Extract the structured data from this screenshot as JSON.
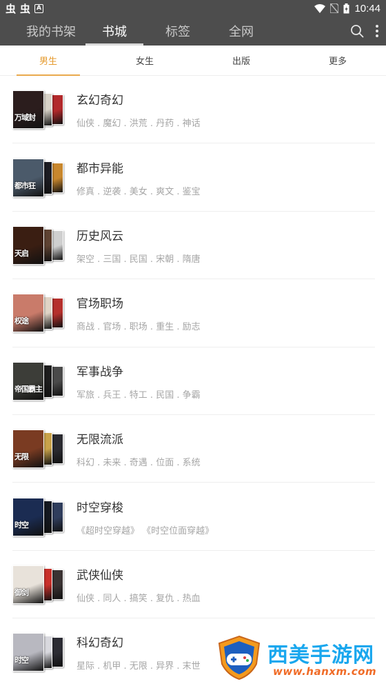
{
  "status_bar": {
    "app_glyphs": [
      "虫",
      "虫"
    ],
    "notif_letter": "A",
    "time": "10:44"
  },
  "top_nav": {
    "tabs": [
      {
        "label": "我的书架",
        "active": false
      },
      {
        "label": "书城",
        "active": true
      },
      {
        "label": "标签",
        "active": false
      },
      {
        "label": "全网",
        "active": false
      }
    ],
    "icons": [
      "search-icon",
      "more-vert-icon"
    ]
  },
  "sub_tabs": [
    {
      "label": "男生",
      "active": true
    },
    {
      "label": "女生",
      "active": false
    },
    {
      "label": "出版",
      "active": false
    },
    {
      "label": "更多",
      "active": false
    }
  ],
  "categories": [
    {
      "name": "玄幻奇幻",
      "tags": "仙侠 . 魔幻 . 洪荒 . 丹药 . 神话",
      "cover_title": "万域封",
      "colors": [
        "#2b1d1d",
        "#d8d2c8",
        "#b2292b"
      ]
    },
    {
      "name": "都市异能",
      "tags": "修真 . 逆袭 . 美女 . 爽文 . 鉴宝",
      "cover_title": "都市狂",
      "colors": [
        "#4b5a6a",
        "#1c1c22",
        "#c8872d"
      ]
    },
    {
      "name": "历史风云",
      "tags": "架空 . 三国 . 民国 . 宋朝 . 隋唐",
      "cover_title": "天启",
      "colors": [
        "#3a1e12",
        "#5e4232",
        "#cfcfcf"
      ]
    },
    {
      "name": "官场职场",
      "tags": "商战 . 官场 . 职场 . 重生 . 励志",
      "cover_title": "权途",
      "colors": [
        "#c97b6a",
        "#e0d4c6",
        "#b5302c"
      ]
    },
    {
      "name": "军事战争",
      "tags": "军旅 . 兵王 . 特工 . 民国 . 争霸",
      "cover_title": "帝国霸主",
      "colors": [
        "#3c3d38",
        "#1d1d1d",
        "#4a4a4a"
      ]
    },
    {
      "name": "无限流派",
      "tags": "科幻 . 未来 . 奇遇 . 位面 . 系统",
      "cover_title": "无限",
      "colors": [
        "#7a3b22",
        "#c9a24a",
        "#2a2a30"
      ]
    },
    {
      "name": "时空穿梭",
      "tags": "《超时空穿越》 《时空位面穿越》",
      "cover_title": "时空",
      "colors": [
        "#1b2c52",
        "#141820",
        "#2f3d5c"
      ]
    },
    {
      "name": "武侠仙侠",
      "tags": "仙侠 . 同人 . 搞笑 . 复仇 . 热血",
      "cover_title": "御剑",
      "colors": [
        "#e8e2da",
        "#c9302a",
        "#3a3232"
      ]
    },
    {
      "name": "科幻奇幻",
      "tags": "星际 . 机甲 . 无限 . 异界 . 末世",
      "cover_title": "时空",
      "colors": [
        "#b8b8c0",
        "#d8d8de",
        "#2c2c34"
      ]
    }
  ],
  "watermark": {
    "title": "西美手游网",
    "url": "www.hanxm.com"
  }
}
